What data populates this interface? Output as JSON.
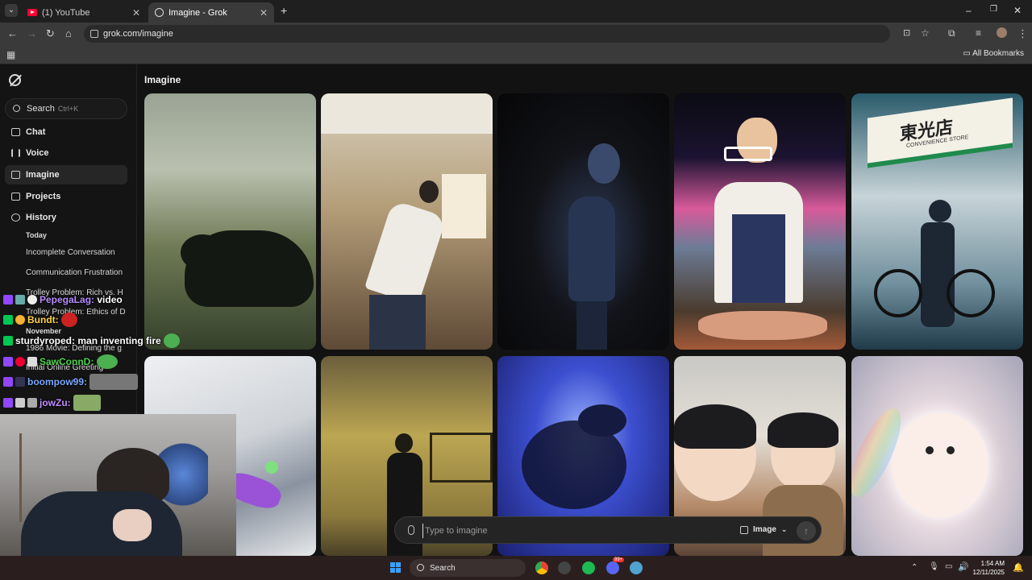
{
  "browser": {
    "tabs": [
      {
        "title": "(1) YouTube",
        "active": false
      },
      {
        "title": "Imagine - Grok",
        "active": true
      }
    ],
    "new_tab": "+",
    "window_controls": [
      "–",
      "❐",
      "✕"
    ],
    "nav": {
      "back": "←",
      "forward": "→",
      "reload": "↻",
      "home": "⌂"
    },
    "url": "grok.com/imagine",
    "bookmarks_label": "All Bookmarks"
  },
  "sidebar": {
    "search_label": "Search",
    "search_shortcut": "Ctrl+K",
    "nav": [
      {
        "label": "Chat",
        "icon": "chat-icon"
      },
      {
        "label": "Voice",
        "icon": "voice-icon"
      },
      {
        "label": "Imagine",
        "icon": "imagine-icon",
        "selected": true
      },
      {
        "label": "Projects",
        "icon": "projects-icon"
      },
      {
        "label": "History",
        "icon": "history-icon"
      }
    ],
    "history": {
      "today_label": "Today",
      "today": [
        "Incomplete Conversation",
        "Communication Frustration",
        "Trolley Problem: Rich vs. H",
        "Trolley Problem: Ethics of D"
      ],
      "november_label": "November",
      "november": [
        "1986 Movie: Defining the g",
        "Initial Online Greeting"
      ]
    }
  },
  "main": {
    "title": "Imagine",
    "tiles": [
      {
        "subject": "black dog on misty lawn"
      },
      {
        "subject": "man dancing in living room"
      },
      {
        "subject": "dark robot figure"
      },
      {
        "subject": "butcher preparing meat"
      },
      {
        "subject": "convenience store at night"
      },
      {
        "subject": "snowboarder on snowy slope"
      },
      {
        "subject": "man in yellow room"
      },
      {
        "subject": "blue glass creature"
      },
      {
        "subject": "anime children in snow"
      },
      {
        "subject": "fluffy white kitten"
      }
    ],
    "store_sign": "東光店",
    "store_sub": "CONVENIENCE STORE",
    "prompt": {
      "placeholder": "Type to imagine",
      "mode_label": "Image",
      "send": "↑"
    }
  },
  "chat": [
    {
      "user": "PepegaLag:",
      "message": "video",
      "color": "#b78cff"
    },
    {
      "user": "Bundt:",
      "message": "",
      "color": "#ffd34a"
    },
    {
      "user": "sturdyroped:",
      "message": "man inventing fire",
      "color": "#ffffff"
    },
    {
      "user": "SawConnD:",
      "message": "",
      "color": "#4dd64d"
    },
    {
      "user": "boompow99:",
      "message": "",
      "color": "#7aa7ff"
    },
    {
      "user": "jowZu:",
      "message": "",
      "color": "#c58cff"
    }
  ],
  "taskbar": {
    "search_label": "Search",
    "time": "1:54 AM",
    "date": "12/11/2025",
    "notification_badge": "99+"
  },
  "colors": {
    "background": "#121212",
    "sidebar": "#141414",
    "chrome": "#3a3a3a"
  }
}
